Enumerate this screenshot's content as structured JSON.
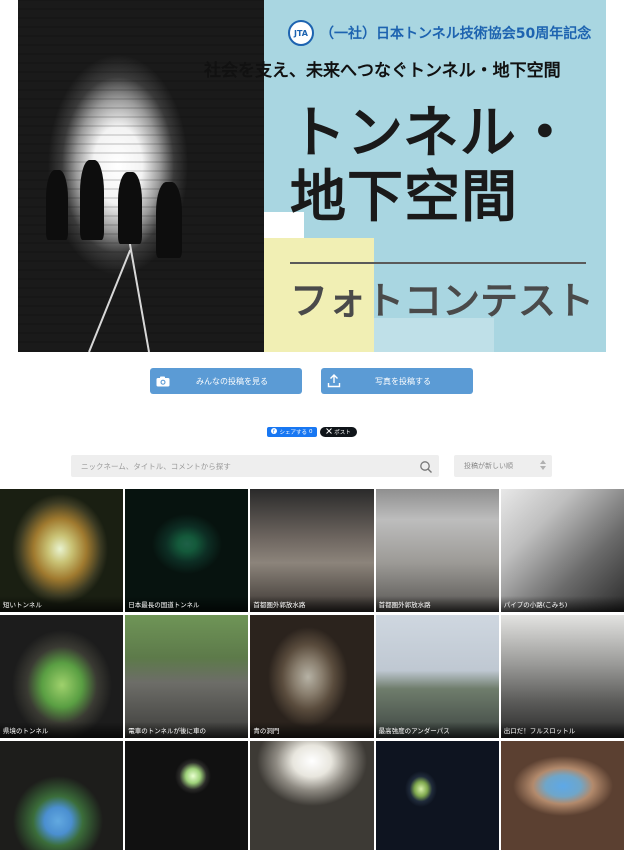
{
  "hero": {
    "org_logo": "JTA",
    "org_line": "（一社）日本トンネル技術協会50周年記念",
    "tagline": "社会を支え、未来へつなぐトンネル・地下空間",
    "title_line1": "トンネル・",
    "title_line2": "地下空間",
    "subtitle": "フォトコンテスト"
  },
  "actions": {
    "view_label": "みんなの投稿を見る",
    "post_label": "写真を投稿する"
  },
  "share": {
    "facebook_label": "シェアする",
    "facebook_count": "0",
    "x_label": "ポスト"
  },
  "search": {
    "placeholder": "ニックネーム、タイトル、コメントから探す",
    "sort_selected": "投稿が新しい順"
  },
  "photos": [
    {
      "title": "短いトンネル"
    },
    {
      "title": "日本最長の国道トンネル"
    },
    {
      "title": "首都圏外郭放水路"
    },
    {
      "title": "首都圏外郭放水路"
    },
    {
      "title": "パイプの小路(こみち)"
    },
    {
      "title": "県境のトンネル"
    },
    {
      "title": "電車のトンネルが後に車の"
    },
    {
      "title": "青の洞門"
    },
    {
      "title": "最高強度のアンダーパス"
    },
    {
      "title": "出口だ！フルスロットル"
    },
    {
      "title": ""
    },
    {
      "title": ""
    },
    {
      "title": ""
    },
    {
      "title": ""
    },
    {
      "title": ""
    }
  ],
  "colors": {
    "hero_blue": "#a9d6e1",
    "hero_yellow": "#f1efb4",
    "button_blue": "#5b9bd5",
    "org_blue": "#1d63b0",
    "facebook_blue": "#1877f2",
    "x_black": "#0f1419"
  },
  "icons": {
    "view_button": "camera-icon",
    "post_button": "upload-icon",
    "search": "search-icon",
    "sort": "sort-arrows-icon",
    "facebook": "facebook-icon",
    "x": "x-logo-icon"
  }
}
